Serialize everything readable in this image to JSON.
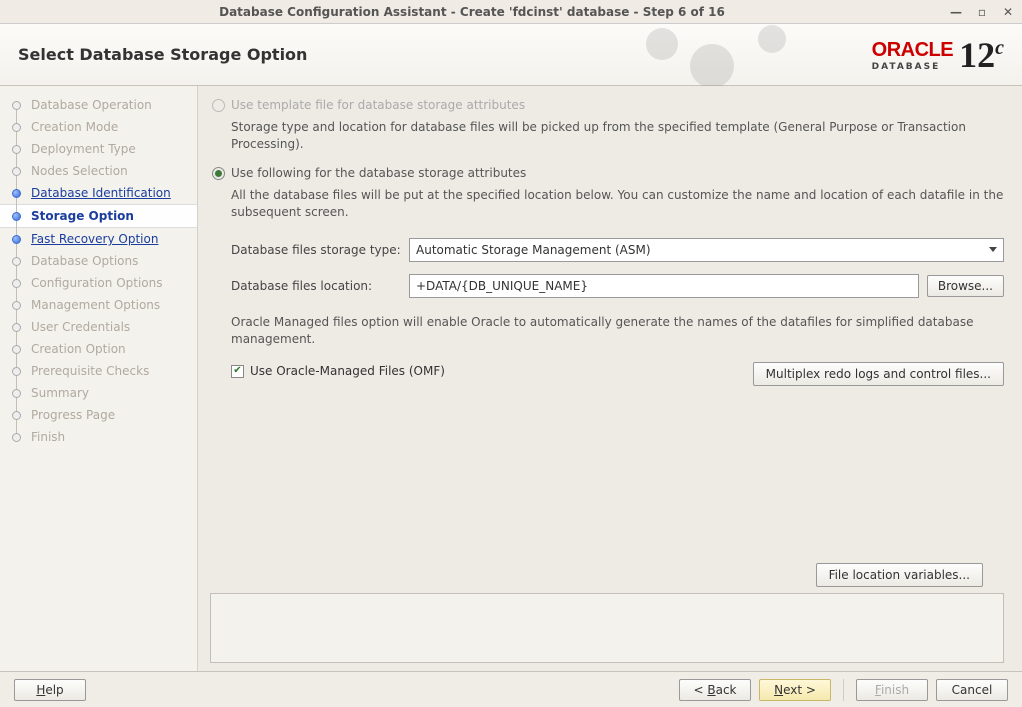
{
  "window": {
    "title": "Database Configuration Assistant - Create 'fdcinst' database - Step 6 of 16"
  },
  "header": {
    "title": "Select Database Storage Option",
    "brand": "ORACLE",
    "brandSub": "DATABASE",
    "version": "12",
    "versionSuffix": "c"
  },
  "steps": [
    {
      "label": "Database Operation",
      "state": "disabled"
    },
    {
      "label": "Creation Mode",
      "state": "disabled"
    },
    {
      "label": "Deployment Type",
      "state": "disabled"
    },
    {
      "label": "Nodes Selection",
      "state": "disabled"
    },
    {
      "label": "Database Identification",
      "state": "link"
    },
    {
      "label": "Storage Option",
      "state": "current"
    },
    {
      "label": "Fast Recovery Option",
      "state": "link"
    },
    {
      "label": "Database Options",
      "state": "disabled"
    },
    {
      "label": "Configuration Options",
      "state": "disabled"
    },
    {
      "label": "Management Options",
      "state": "disabled"
    },
    {
      "label": "User Credentials",
      "state": "disabled"
    },
    {
      "label": "Creation Option",
      "state": "disabled"
    },
    {
      "label": "Prerequisite Checks",
      "state": "disabled"
    },
    {
      "label": "Summary",
      "state": "disabled"
    },
    {
      "label": "Progress Page",
      "state": "disabled"
    },
    {
      "label": "Finish",
      "state": "disabled"
    }
  ],
  "option1": {
    "label": "Use template file for database storage attributes",
    "desc": "Storage type and location for database files will be picked up from the specified template (General Purpose or Transaction Processing)."
  },
  "option2": {
    "label": "Use following for the database storage attributes",
    "desc": "All the database files will be put at the specified location below. You can customize the name and location of each datafile in the subsequent screen."
  },
  "form": {
    "typeLabel": "Database files storage type:",
    "typeValue": "Automatic Storage Management (ASM)",
    "locLabel": "Database files location:",
    "locValue": "+DATA/{DB_UNIQUE_NAME}",
    "browse": "Browse...",
    "omfDesc": "Oracle Managed files option will enable Oracle to automatically generate the names of the datafiles for simplified database management.",
    "omfLabel": "Use Oracle-Managed Files (OMF)",
    "multiplex": "Multiplex redo logs and control files...",
    "fileVars": "File location variables..."
  },
  "footer": {
    "help": "Help",
    "back": "< Back",
    "next": "Next >",
    "finish": "Finish",
    "cancel": "Cancel"
  }
}
